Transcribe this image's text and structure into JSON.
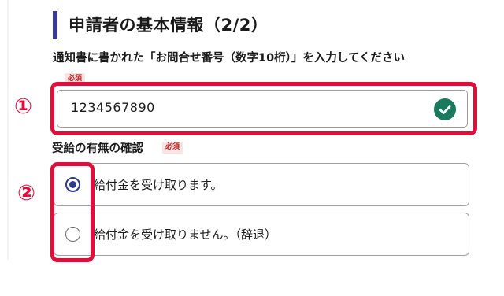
{
  "section": {
    "title": "申請者の基本情報（2/2）"
  },
  "inquiry_field": {
    "label": "通知書に書かれた「お問合せ番号（数字10桁）」を入力してください",
    "required_badge": "必須",
    "value": "1234567890",
    "status_icon": "check-circle-icon",
    "status_color": "#1a7a5e"
  },
  "receipt_question": {
    "label": "受給の有無の確認",
    "required_badge": "必須",
    "options": [
      {
        "label": "給付金を受け取ります。",
        "selected": true
      },
      {
        "label": "給付金を受け取りません。（辞退）",
        "selected": false
      }
    ]
  },
  "annotations": {
    "marker_1": "①",
    "marker_2": "②",
    "color": "#e00e3a"
  },
  "colors": {
    "accent": "#3a3a9c",
    "radio_selected": "#2f3a8f",
    "required_bg": "#fbe3e3",
    "required_text": "#c31e1e"
  }
}
